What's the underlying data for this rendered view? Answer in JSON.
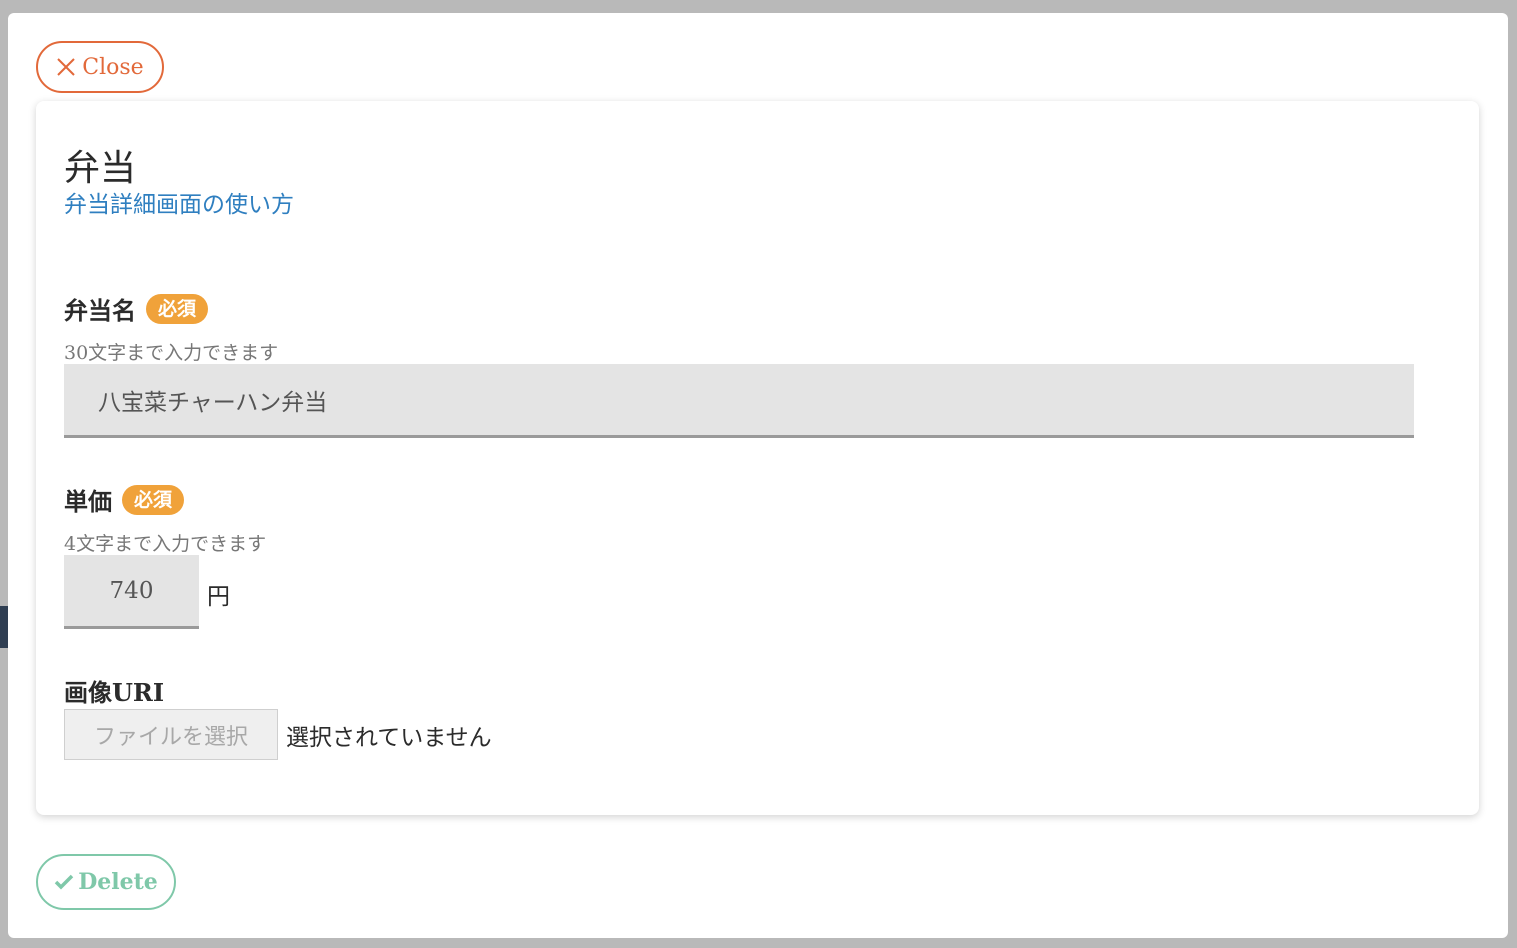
{
  "modal": {
    "close_label": "Close",
    "delete_label": "Delete"
  },
  "header": {
    "title": "弁当",
    "help_link": "弁当詳細画面の使い方"
  },
  "fields": {
    "name": {
      "label": "弁当名",
      "badge": "必須",
      "hint": "30文字まで入力できます",
      "value": "八宝菜チャーハン弁当"
    },
    "price": {
      "label": "単価",
      "badge": "必須",
      "hint": "4文字まで入力できます",
      "value": "740",
      "unit": "円"
    },
    "image": {
      "label": "画像URI",
      "button_label": "ファイルを選択",
      "status": "選択されていません"
    }
  },
  "colors": {
    "close_accent": "#e2693a",
    "delete_accent": "#7fc8a9",
    "badge": "#f0a23a",
    "link": "#2f7fc0"
  },
  "icons": {
    "close": "close-icon",
    "delete": "check-icon"
  }
}
